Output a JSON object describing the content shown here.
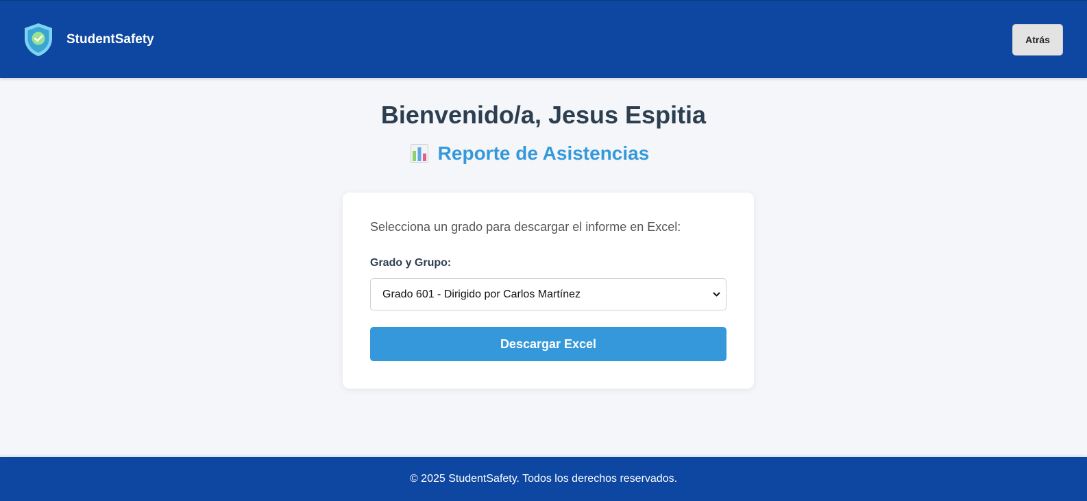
{
  "header": {
    "brand_name": "StudentSafety",
    "logo_icon": "shield-check-icon",
    "back_label": "Atrás",
    "background_color": "#0d47a1"
  },
  "main": {
    "welcome_title": "Bienvenido/a, Jesus Espitia",
    "report_icon": "bar-chart-icon",
    "report_title": "Reporte de Asistencias",
    "accent_color": "#3498db"
  },
  "card": {
    "instruction": "Selecciona un grado para descargar el informe en Excel:",
    "field_label": "Grado y Grupo:",
    "select_value": "Grado 601 - Dirigido por Carlos Martínez",
    "download_label": "Descargar Excel"
  },
  "footer": {
    "text": "© 2025 StudentSafety. Todos los derechos reservados."
  }
}
